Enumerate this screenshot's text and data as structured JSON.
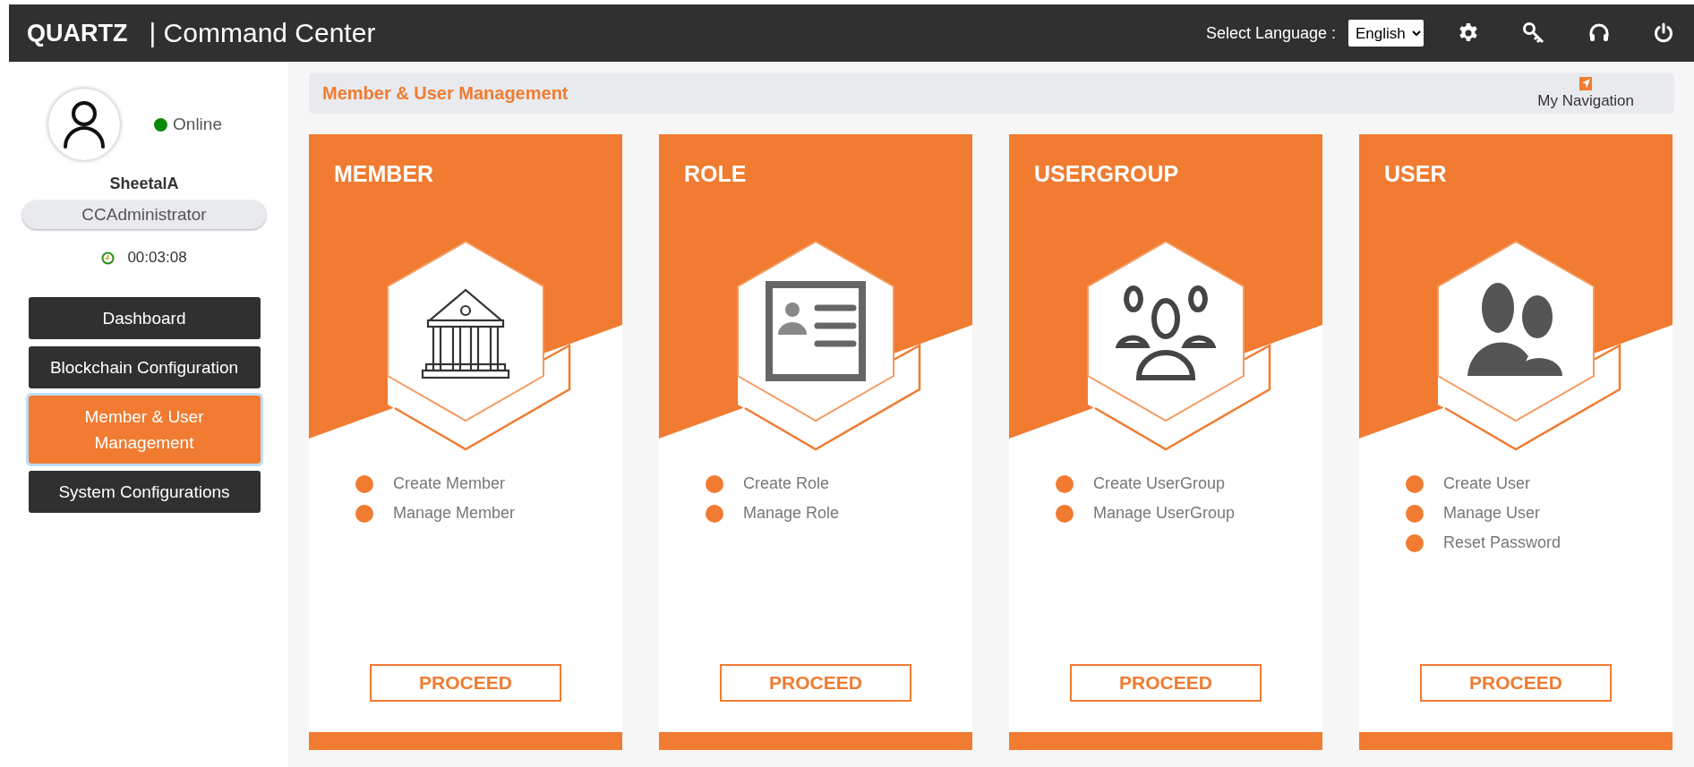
{
  "header": {
    "brand": "QUARTZ",
    "title": "| Command Center",
    "language_label": "Select Language :",
    "language": "English"
  },
  "user": {
    "name": "SheetalA",
    "role": "CCAdministrator",
    "online": true,
    "status": "Online",
    "session_time": "00:03:08"
  },
  "nav": [
    {
      "label": "Dashboard",
      "selected": false
    },
    {
      "label": "Blockchain Configuration",
      "selected": false
    },
    {
      "label": "Member & User Management",
      "selected": true
    },
    {
      "label": "System Configurations",
      "selected": false
    }
  ],
  "breadcrumb": {
    "title": "Member & User Management",
    "navigation": "My Navigation"
  },
  "cards": [
    {
      "title": "MEMBER",
      "kind": "bank",
      "actions": [
        "Create Member",
        "Manage Member"
      ],
      "button": "PROCEED"
    },
    {
      "title": "ROLE",
      "kind": "id-card",
      "actions": [
        "Create Role",
        "Manage Role"
      ],
      "button": "PROCEED"
    },
    {
      "title": "USERGROUP",
      "kind": "group",
      "actions": [
        "Create UserGroup",
        "Manage UserGroup"
      ],
      "button": "PROCEED"
    },
    {
      "title": "USER",
      "kind": "users",
      "actions": [
        "Create User",
        "Manage User",
        "Reset Password"
      ],
      "button": "PROCEED"
    }
  ]
}
